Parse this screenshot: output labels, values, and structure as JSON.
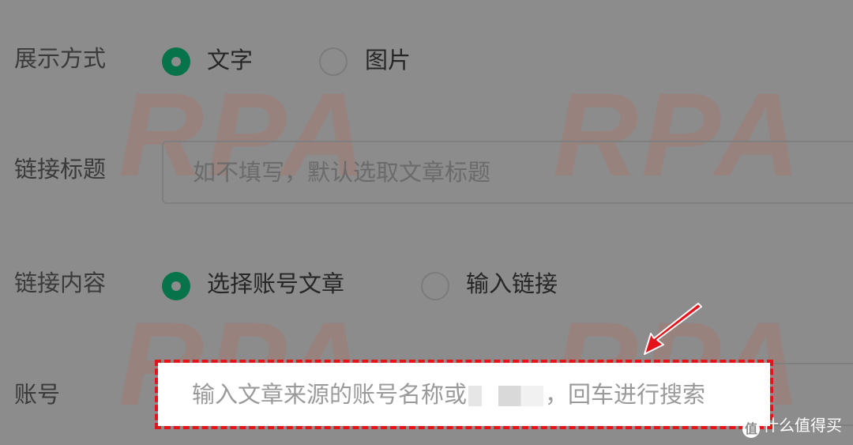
{
  "watermark": {
    "text": "RPA"
  },
  "form": {
    "display_mode": {
      "label": "展示方式",
      "options": [
        {
          "label": "文字",
          "selected": true
        },
        {
          "label": "图片",
          "selected": false
        }
      ]
    },
    "link_title": {
      "label": "链接标题",
      "placeholder": "如不填写，默认选取文章标题"
    },
    "link_content": {
      "label": "链接内容",
      "options": [
        {
          "label": "选择账号文章",
          "selected": true
        },
        {
          "label": "输入链接",
          "selected": false
        }
      ]
    },
    "account": {
      "label": "账号",
      "placeholder_prefix": "输入文章来源的账号名称或",
      "placeholder_suffix": "，回车进行搜索"
    }
  },
  "brand": {
    "badge": "值",
    "name": "什么值得买"
  },
  "colors": {
    "accent": "#07734a",
    "highlight": "#e3151b",
    "overlay": "#8c8c8c"
  },
  "icons": {
    "arrow": "arrow-pointer-icon",
    "badge": "smzdm-badge-icon"
  }
}
